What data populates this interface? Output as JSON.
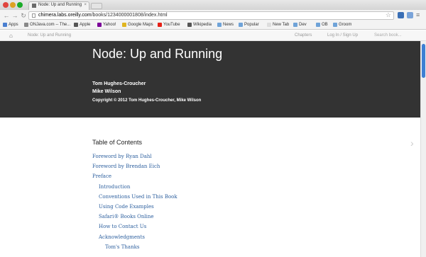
{
  "browser": {
    "tab_title": "Node: Up and Running",
    "tab_close": "×",
    "url_host": "chimera.labs.oreilly.com",
    "url_path": "/books/1234000001808/index.html",
    "star_icon": "☆",
    "back_icon": "←",
    "forward_icon": "→",
    "reload_icon": "↻",
    "menu_icon": "≡"
  },
  "bookmarks": [
    {
      "label": "Apps",
      "color": "#4a7fd0"
    },
    {
      "label": "ONJava.com -- The...",
      "color": "#888888"
    },
    {
      "label": "Apple",
      "color": "#555555"
    },
    {
      "label": "Yahoo!",
      "color": "#7b0099"
    },
    {
      "label": "Google Maps",
      "color": "#e0b520"
    },
    {
      "label": "YouTube",
      "color": "#e62117"
    },
    {
      "label": "Wikipedia",
      "color": "#555555"
    },
    {
      "label": "News",
      "color": "#6fa3d8"
    },
    {
      "label": "Popular",
      "color": "#6fa3d8"
    },
    {
      "label": "New Tab",
      "color": "#dddddd"
    },
    {
      "label": "Dev",
      "color": "#6fa3d8"
    },
    {
      "label": "OB",
      "color": "#6fa3d8"
    },
    {
      "label": "Groom",
      "color": "#6fa3d8"
    }
  ],
  "sitenav": {
    "home_icon": "⌂",
    "crumb": "Node: Up and Running",
    "chapters": "Chapters",
    "login": "Log In / Sign Up",
    "search_placeholder": "Search book..."
  },
  "hero": {
    "title": "Node: Up and Running",
    "authors": [
      "Tom Hughes-Croucher",
      "Mike Wilson"
    ],
    "copyright": "Copyright © 2012 Tom Hughes-Croucher, Mike Wilson"
  },
  "toc": {
    "title": "Table of Contents",
    "next_icon": "›",
    "items": [
      {
        "label": "Foreword by Ryan Dahl",
        "level": 0
      },
      {
        "label": "Foreword by Brendan Eich",
        "level": 0
      },
      {
        "label": "Preface",
        "level": 0
      },
      {
        "label": "Introduction",
        "level": 1
      },
      {
        "label": "Conventions Used in This Book",
        "level": 1
      },
      {
        "label": "Using Code Examples",
        "level": 1
      },
      {
        "label": "Safari® Books Online",
        "level": 1
      },
      {
        "label": "How to Contact Us",
        "level": 1
      },
      {
        "label": "Acknowledgments",
        "level": 1
      },
      {
        "label": "Tom's Thanks",
        "level": 2
      }
    ]
  },
  "colors": {
    "hero_bg": "#333333",
    "link": "#2c5f9e",
    "scroll_thumb": "#3d7fd3"
  }
}
